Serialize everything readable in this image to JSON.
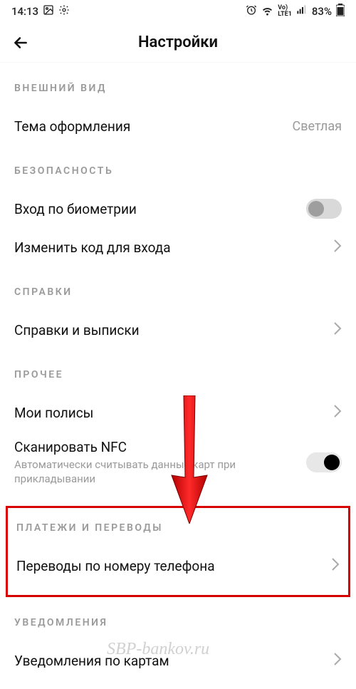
{
  "status": {
    "time": "14:13",
    "battery": "83%"
  },
  "header": {
    "title": "Настройки"
  },
  "sections": {
    "appearance": {
      "header": "Внешний вид",
      "theme_label": "Тема оформления",
      "theme_value": "Светлая"
    },
    "security": {
      "header": "Безопасность",
      "biometrics_label": "Вход по биометрии",
      "change_code_label": "Изменить код для входа"
    },
    "reference": {
      "header": "Справки",
      "statements_label": "Справки и выписки"
    },
    "other": {
      "header": "Прочее",
      "policies_label": "Мои полисы",
      "nfc_label": "Сканировать NFC",
      "nfc_sub": "Автоматически считывать данные карт при прикладывании"
    },
    "payments": {
      "header": "Платежи и переводы",
      "transfers_label": "Переводы по номеру телефона"
    },
    "notifications": {
      "header": "Уведомления",
      "cards_label": "Уведомления по картам"
    }
  },
  "watermark": "SBP-bankov.ru"
}
